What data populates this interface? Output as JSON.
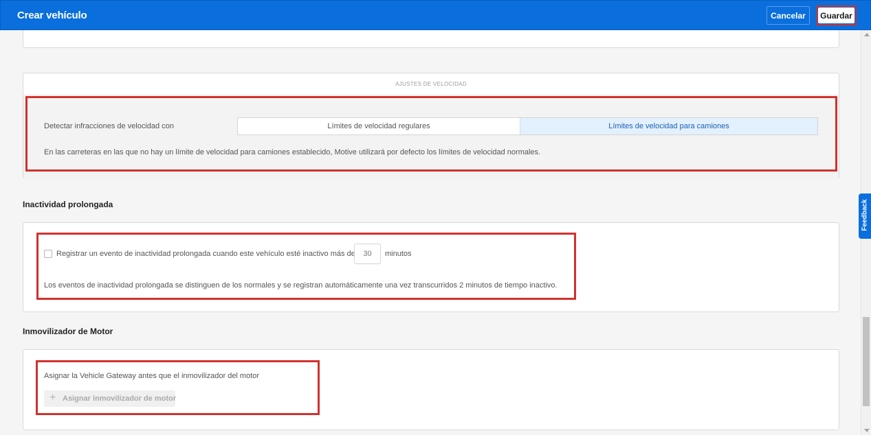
{
  "header": {
    "title": "Crear vehículo",
    "cancel_label": "Cancelar",
    "save_label": "Guardar"
  },
  "speed_settings": {
    "section_header": "AJUSTES DE VELOCIDAD",
    "detect_label": "Detectar infracciones de velocidad con",
    "options": [
      "Límites de velocidad regulares",
      "Límites de velocidad para camiones"
    ],
    "selected_option": "Límites de velocidad para camiones",
    "note": "En las carreteras en las que no hay un límite de velocidad para camiones establecido, Motive utilizará por defecto los límites de velocidad normales."
  },
  "idle": {
    "title": "Inactividad prolongada",
    "checkbox_label": "Registrar un evento de inactividad prolongada cuando este vehículo esté inactivo más de",
    "checked": false,
    "minutes_placeholder": "30",
    "minutes_unit": "minutos",
    "note": "Los eventos de inactividad prolongada se distinguen de los normales y se registran automáticamente una vez transcurridos 2 minutos de tiempo inactivo."
  },
  "engine": {
    "title": "Inmovilizador de Motor",
    "note": "Asignar la Vehicle Gateway antes que el inmovilizador del motor",
    "assign_label": "Asignar inmovilizador de motor",
    "plus_icon": "+"
  },
  "feedback": {
    "label": "Feedback"
  },
  "colors": {
    "brand_blue": "#0a6fdc",
    "highlight_red": "#d0312d",
    "selected_segment_bg": "#e3f0fd"
  }
}
